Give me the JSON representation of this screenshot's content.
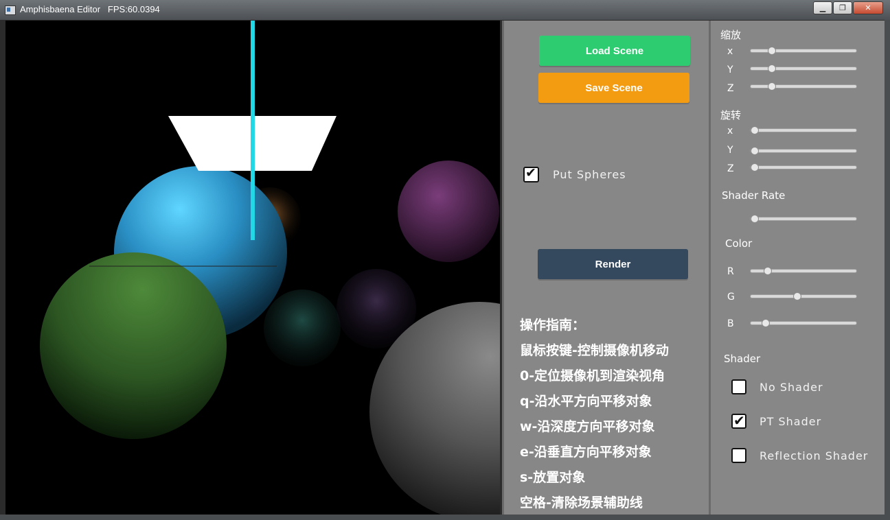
{
  "window": {
    "title": "Amphisbaena Editor   FPS:60.0394",
    "minimize": "▁",
    "maximize": "❐",
    "close": "✕"
  },
  "colors": {
    "load_button": "#2ecc71",
    "save_button": "#f39c12",
    "render_button": "#34495e",
    "panel_bg": "#878787",
    "guide_cyan": "#22d8e6"
  },
  "controls": {
    "load_scene": "Load Scene",
    "save_scene": "Save Scene",
    "put_spheres": {
      "label": "Put Spheres",
      "checked": true
    },
    "render": "Render"
  },
  "guide": {
    "title": "操作指南：",
    "lines": [
      "鼠标按键-控制摄像机移动",
      "0-定位摄像机到渲染视角",
      "q-沿水平方向平移对象",
      "w-沿深度方向平移对象",
      "e-沿垂直方向平移对象",
      "s-放置对象",
      "空格-清除场景辅助线"
    ]
  },
  "properties": {
    "scale": {
      "title": "缩放",
      "x": {
        "label": "x",
        "value": 0.2
      },
      "y": {
        "label": "Y",
        "value": 0.2
      },
      "z": {
        "label": "Z",
        "value": 0.2
      }
    },
    "rotation": {
      "title": "旋转",
      "x": {
        "label": "x",
        "value": 0.04
      },
      "y": {
        "label": "Y",
        "value": 0.04
      },
      "z": {
        "label": "Z",
        "value": 0.04
      }
    },
    "shader_rate": {
      "title": "Shader Rate",
      "value": 0.04
    },
    "color": {
      "title": "Color",
      "r": {
        "label": "R",
        "value": 0.16
      },
      "g": {
        "label": "G",
        "value": 0.44
      },
      "b": {
        "label": "B",
        "value": 0.14
      }
    },
    "shader": {
      "title": "Shader",
      "options": [
        {
          "label": "No Shader",
          "checked": false
        },
        {
          "label": "PT Shader",
          "checked": true
        },
        {
          "label": "Reflection Shader",
          "checked": false
        }
      ]
    }
  }
}
